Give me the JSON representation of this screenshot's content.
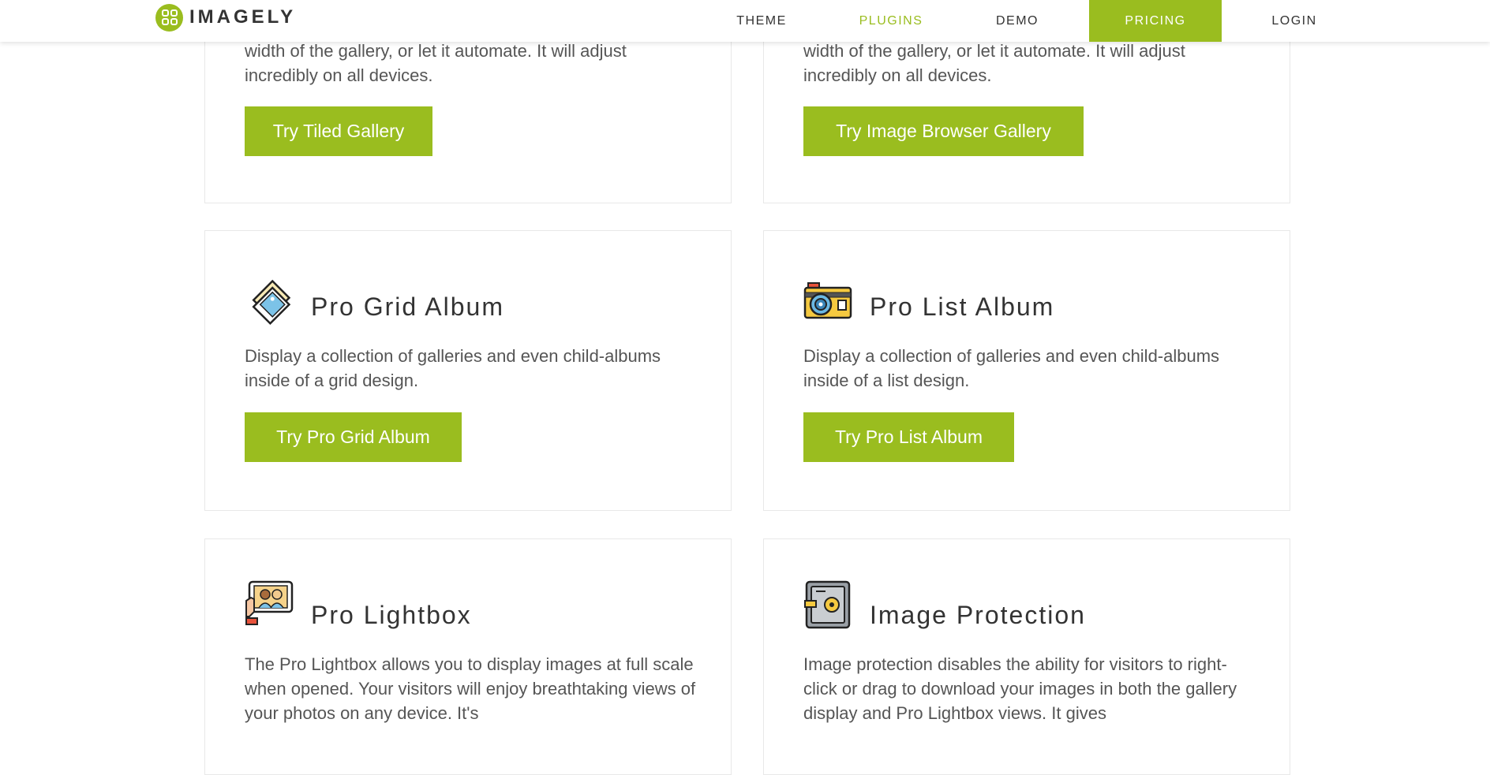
{
  "brand": {
    "name": "IMAGELY",
    "accent": "#9abd1f"
  },
  "nav": {
    "theme": "THEME",
    "plugins": "PLUGINS",
    "demo": "DEMO",
    "pricing": "PRICING",
    "login": "LOGIN"
  },
  "cards": {
    "tiled": {
      "desc": "width of the gallery, or let it automate. It will adjust incredibly on all devices.",
      "button": "Try Tiled Gallery"
    },
    "browser": {
      "desc": "width of the gallery, or let it automate. It will adjust incredibly on all devices.",
      "button": "Try Image Browser Gallery"
    },
    "grid_album": {
      "title": "Pro Grid Album",
      "desc": "Display a collection of galleries and even child-albums inside of a grid design.",
      "button": "Try Pro Grid Album",
      "icon": "photo-stack-icon"
    },
    "list_album": {
      "title": "Pro List Album",
      "desc": "Display a collection of galleries and even child-albums inside of a list design.",
      "button": "Try Pro List Album",
      "icon": "camera-icon"
    },
    "lightbox": {
      "title": "Pro Lightbox",
      "desc": "The Pro Lightbox allows you to display images at full scale when opened. Your visitors will enjoy breathtaking views of your photos on any device. It's",
      "icon": "tablet-photo-icon"
    },
    "protection": {
      "title": "Image Protection",
      "desc": "Image protection disables the ability for visitors to right-click or drag to download your images in both the gallery display and Pro Lightbox views. It gives",
      "icon": "safe-icon"
    }
  }
}
